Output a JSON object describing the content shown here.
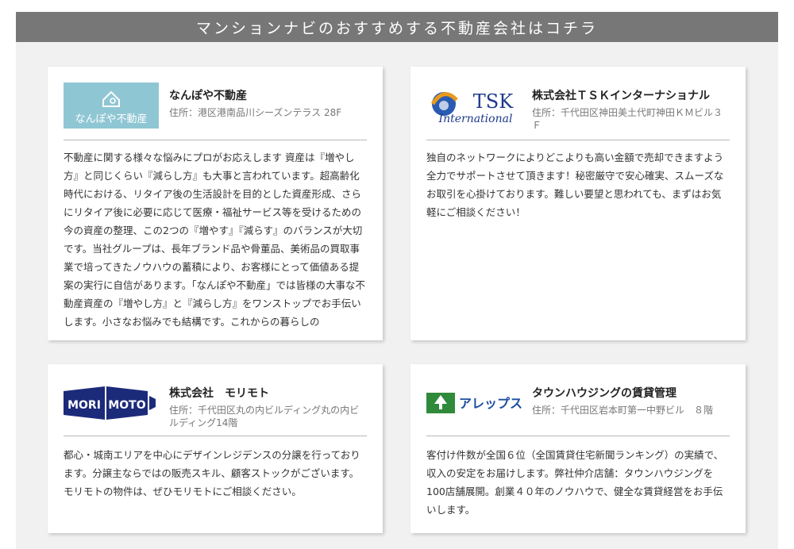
{
  "banner": {
    "title": "マンションナビのおすすめする不動産会社はコチラ"
  },
  "cards": [
    {
      "name": "なんぽや不動産",
      "address": "住所：港区港南品川シーズンテラス 28F",
      "logo_text": "なんぽや不動産",
      "logo_color": "#8fc6d4",
      "description": "不動産に関する様々な悩みにプロがお応えします 資産は『増やし方』と同じくらい『減らし方』も大事と言われています。超高齢化時代における、リタイア後の生活設計を目的とした資産形成、さらにリタイア後に必要に応じて医療・福祉サービス等を受けるための今の資産の整理、この2つの『増やす』『減らす』のバランスが大切です。当社グループは、長年ブランド品や骨董品、美術品の買取事業で培ってきたノウハウの蓄積により、お客様にとって価値ある提案の実行に自信があります。「なんぽや不動産」では皆様の大事な不動産資産の『増やし方』と『減らし方』をワンストップでお手伝いします。小さなお悩みでも結構です。これからの暮らしの"
    },
    {
      "name": "株式会社ＴＳＫインターナショナル",
      "address": "住所：千代田区神田美土代町神田ＫＭビル３Ｆ",
      "logo_text_main": "TSK",
      "logo_text_sub": "International",
      "logo_color": "#1e3a8c",
      "description": "独自のネットワークによりどこよりも高い金額で売却できますよう全力でサポートさせて頂きます！秘密厳守で安心確実、スムーズなお取引を心掛けております。難しい要望と思われても、まずはお気軽にご相談ください！"
    },
    {
      "name": "株式会社　モリモト",
      "address": "住所：千代田区丸の内ビルディング丸の内ビルディング14階",
      "logo_text_left": "MORI",
      "logo_text_right": "MOTO",
      "logo_color": "#1c2a7a",
      "description": "都心・城南エリアを中心にデザインレジデンスの分譲を行っております。分譲主ならではの販売スキル、顧客ストックがございます。モリモトの物件は、ぜひモリモトにご相談ください。"
    },
    {
      "name": "タウンハウジングの賃貸管理",
      "address": "住所：千代田区岩本町第一中野ビル　８階",
      "logo_text": "アレップス",
      "logo_color": "#2f8a3a",
      "description": "客付け件数が全国６位（全国賃貸住宅新聞ランキング）の実績で、収入の安定をお届けします。弊社仲介店舗：タウンハウジングを100店舗展開。創業４０年のノウハウで、健全な賃貸経営をお手伝いします。"
    }
  ]
}
